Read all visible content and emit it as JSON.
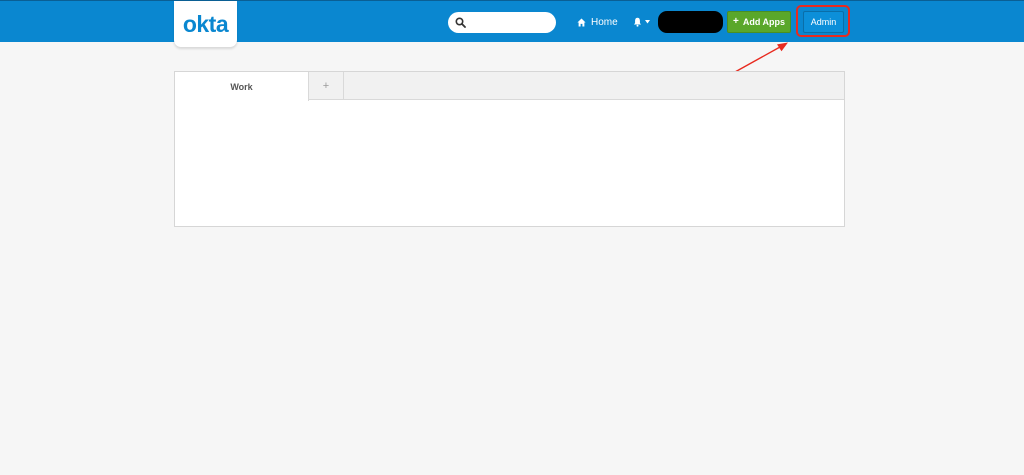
{
  "header": {
    "logo_text": "okta",
    "search": {
      "placeholder": ""
    },
    "home_label": "Home",
    "add_apps_label": "Add Apps",
    "admin_label": "Admin"
  },
  "dashboard": {
    "tabs": [
      {
        "label": "Work"
      },
      {
        "label": "+"
      }
    ]
  },
  "colors": {
    "header_blue": "#0a87d0",
    "add_apps_green": "#5aa72a",
    "annotation_red": "#e82a1f"
  },
  "icons": [
    "search-icon",
    "home-icon",
    "bell-icon",
    "caret-down-icon",
    "plus-icon"
  ]
}
